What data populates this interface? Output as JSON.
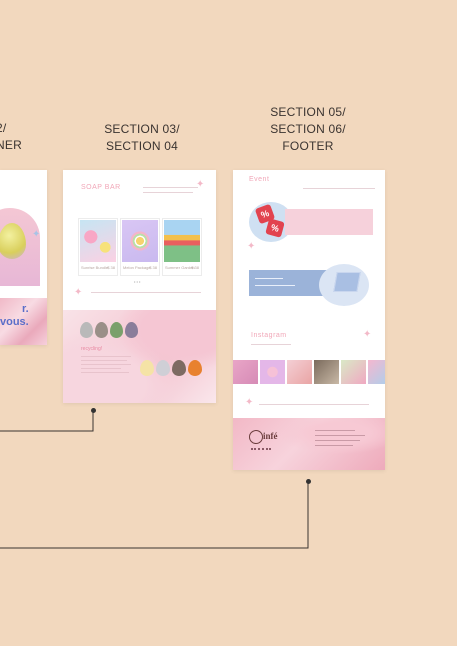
{
  "labels": {
    "left": {
      "line1": "2/",
      "line2": "NER"
    },
    "middle": {
      "line1": "SECTION 03/",
      "line2": "SECTION 04"
    },
    "right": {
      "line1": "SECTION 05/",
      "line2": "SECTION 06/",
      "line3": "FOOTER"
    }
  },
  "left_board": {
    "banner_text1": "r.",
    "banner_text2": "vous."
  },
  "middle_board": {
    "section_title": "SOAP BAR",
    "products": [
      {
        "name": "Sunrise Bundle",
        "price": "$ 38"
      },
      {
        "name": "Melon Package",
        "price": "$ 38"
      },
      {
        "name": "Summer Garden",
        "price": "$ 38"
      }
    ],
    "more_dots": "• • •",
    "sub_title": "recycling!"
  },
  "right_board": {
    "event_title": "Event",
    "instagram_title": "Instagram",
    "brand": "infé"
  },
  "colors": {
    "background": "#f2d8be",
    "accent_pink": "#f1a7b8",
    "accent_blue": "#9bb3d9"
  }
}
